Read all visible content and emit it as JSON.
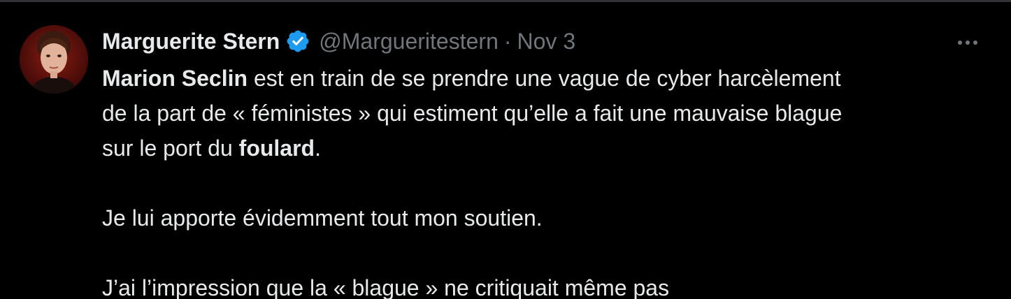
{
  "tweet": {
    "author": {
      "name": "Marguerite Stern",
      "handle": "@Margueritestern",
      "verified": true,
      "avatar_icon": "profile-photo"
    },
    "separator": "·",
    "date": "Nov 3",
    "more_icon": "more-horizontal-icon",
    "body": {
      "para1": {
        "mention_name": "Marion Seclin",
        "line1_rest": " est en train de se prendre une vague de cyber harcèlement",
        "line2": "de la part de « féministes » qui estiment qu’elle a fait une mauvaise blague",
        "line3_start": "sur le port du ",
        "line3_bold": "foulard",
        "line3_end": "."
      },
      "para2": "Je lui apporte évidemment tout mon soutien.",
      "para3": "J’ai l’impression que la « blague » ne critiquait même pas"
    }
  },
  "colors": {
    "background": "#000000",
    "primary_text": "#e7e9ea",
    "secondary_text": "#71767b",
    "verified_badge": "#1d9bf0",
    "top_border": "#2f3336"
  }
}
